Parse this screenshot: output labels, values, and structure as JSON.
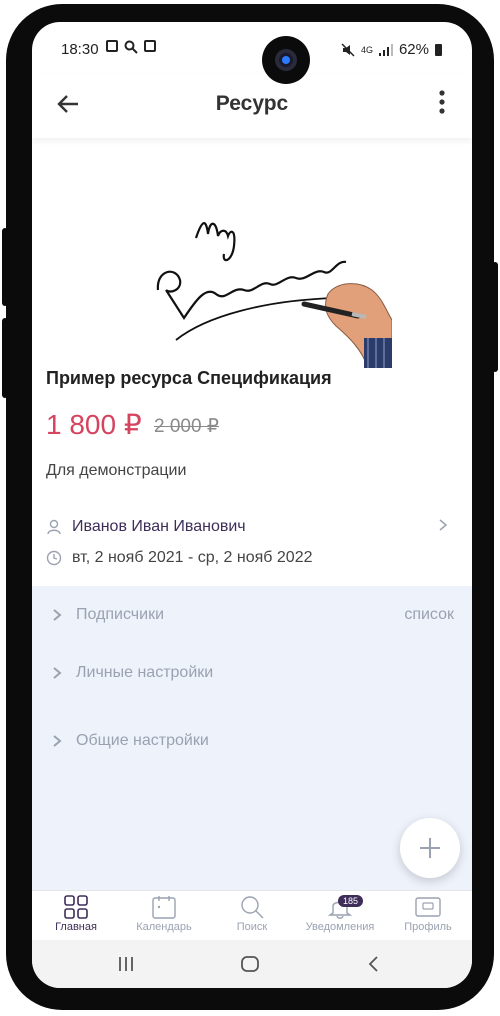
{
  "status_bar": {
    "time": "18:30",
    "battery": "62%",
    "signal_text": "4G"
  },
  "app_bar": {
    "title": "Ресурс",
    "back_icon": "arrow-left-icon",
    "menu_icon": "more-vertical-icon"
  },
  "hero_image": {
    "icon": "my-resources-illustration",
    "lettering": "My Resources"
  },
  "resource": {
    "name": "Пример ресурса Спецификация",
    "price": "1 800 ₽",
    "old_price": "2 000 ₽",
    "description": "Для демонстрации"
  },
  "info": {
    "owner": "Иванов Иван Иванович",
    "period": "вт, 2 нояб 2021 - ср, 2 нояб 2022"
  },
  "settings": {
    "subscribers_label": "Подписчики",
    "subscribers_link": "список",
    "personal_label": "Личные настройки",
    "general_label": "Общие настройки"
  },
  "bottom_nav": {
    "items": [
      {
        "label": "Главная",
        "icon": "grid-icon"
      },
      {
        "label": "Календарь",
        "icon": "calendar-icon"
      },
      {
        "label": "Поиск",
        "icon": "search-icon"
      },
      {
        "label": "Уведомления",
        "icon": "bell-icon",
        "badge": "185"
      },
      {
        "label": "Профиль",
        "icon": "profile-card-icon"
      }
    ]
  },
  "colors": {
    "accent": "#3f2d59",
    "price": "#d6435f",
    "settings_bg": "#eef2fb"
  }
}
